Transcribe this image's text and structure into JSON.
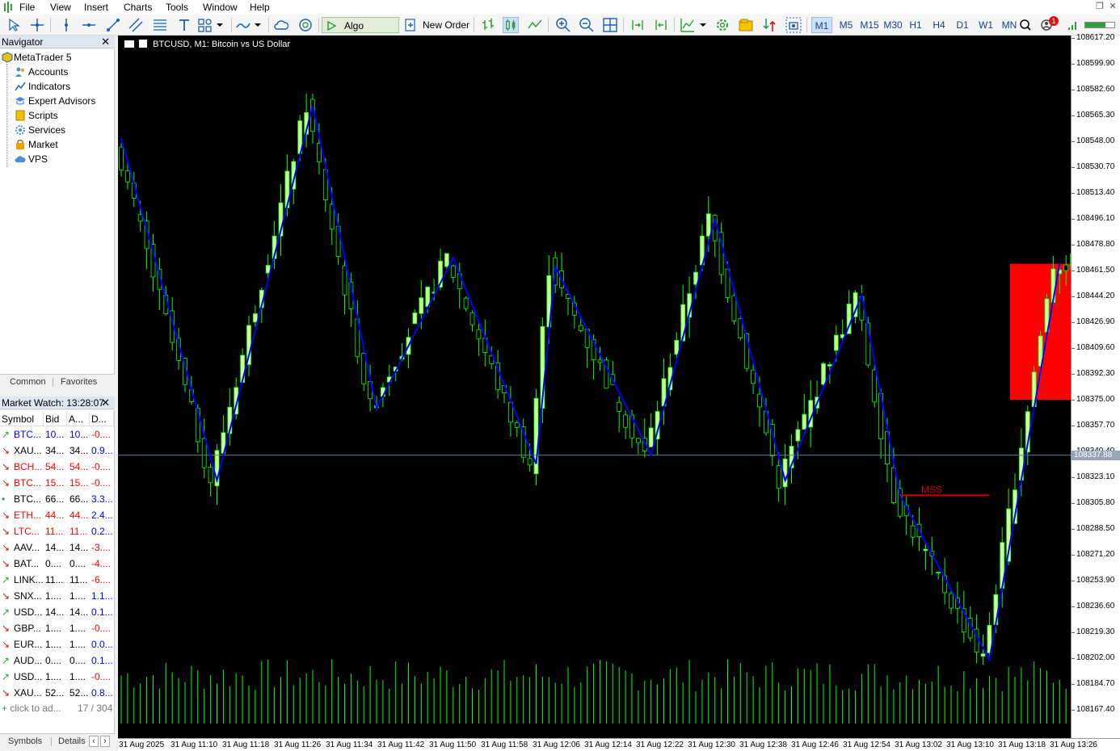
{
  "menu": [
    "File",
    "View",
    "Insert",
    "Charts",
    "Tools",
    "Window",
    "Help"
  ],
  "toolbar": {
    "algo_trading": "Algo Trading",
    "new_order": "New Order",
    "timeframes": [
      "M1",
      "M5",
      "M15",
      "M30",
      "H1",
      "H4",
      "D1",
      "W1",
      "MN"
    ],
    "active_timeframe": "M1",
    "notification_count": "1"
  },
  "navigator": {
    "title": "Navigator",
    "root": "MetaTrader 5",
    "items": [
      "Accounts",
      "Indicators",
      "Expert Advisors",
      "Scripts",
      "Services",
      "Market",
      "VPS"
    ],
    "tabs": [
      "Common",
      "Favorites"
    ]
  },
  "market_watch": {
    "title": "Market Watch: 13:28:07",
    "columns": [
      "Symbol",
      "Bid",
      "A...",
      "D..."
    ],
    "rows": [
      {
        "symbol": "BTC...",
        "bid": "10...",
        "ask": "10...",
        "daily": "-0....",
        "dir": "up",
        "color": "#0000ff",
        "dcolor": "#ff0000"
      },
      {
        "symbol": "XAU...",
        "bid": "34...",
        "ask": "34...",
        "daily": "0.9...",
        "dir": "down",
        "color": "#000000",
        "dcolor": "#0000ff"
      },
      {
        "symbol": "BCH...",
        "bid": "54...",
        "ask": "54...",
        "daily": "-0....",
        "dir": "down",
        "color": "#ff0000",
        "dcolor": "#ff0000"
      },
      {
        "symbol": "BTC...",
        "bid": "15...",
        "ask": "15...",
        "daily": "-0....",
        "dir": "down",
        "color": "#ff0000",
        "dcolor": "#ff0000"
      },
      {
        "symbol": "BTC...",
        "bid": "66...",
        "ask": "66...",
        "daily": "3.3...",
        "dir": "neutral",
        "color": "#000000",
        "dcolor": "#0000ff"
      },
      {
        "symbol": "ETH...",
        "bid": "44...",
        "ask": "44...",
        "daily": "2.4...",
        "dir": "down",
        "color": "#ff0000",
        "dcolor": "#0000ff"
      },
      {
        "symbol": "LTC...",
        "bid": "11...",
        "ask": "11...",
        "daily": "0.2...",
        "dir": "down",
        "color": "#ff0000",
        "dcolor": "#0000ff"
      },
      {
        "symbol": "AAV...",
        "bid": "14...",
        "ask": "14...",
        "daily": "-3....",
        "dir": "down",
        "color": "#000000",
        "dcolor": "#ff0000"
      },
      {
        "symbol": "BAT...",
        "bid": "0....",
        "ask": "0....",
        "daily": "-4....",
        "dir": "down",
        "color": "#000000",
        "dcolor": "#ff0000"
      },
      {
        "symbol": "LINK...",
        "bid": "11...",
        "ask": "11...",
        "daily": "-6....",
        "dir": "up",
        "color": "#000000",
        "dcolor": "#ff0000"
      },
      {
        "symbol": "SNX...",
        "bid": "1....",
        "ask": "1....",
        "daily": "1.1...",
        "dir": "down",
        "color": "#000000",
        "dcolor": "#0000ff"
      },
      {
        "symbol": "USD...",
        "bid": "14...",
        "ask": "14...",
        "daily": "0.1...",
        "dir": "up",
        "color": "#000000",
        "dcolor": "#0000ff"
      },
      {
        "symbol": "GBP...",
        "bid": "1....",
        "ask": "1....",
        "daily": "-0....",
        "dir": "down",
        "color": "#000000",
        "dcolor": "#ff0000"
      },
      {
        "symbol": "EUR...",
        "bid": "1....",
        "ask": "1....",
        "daily": "0.0...",
        "dir": "down",
        "color": "#000000",
        "dcolor": "#0000ff"
      },
      {
        "symbol": "AUD...",
        "bid": "0....",
        "ask": "0....",
        "daily": "0.1...",
        "dir": "up",
        "color": "#000000",
        "dcolor": "#0000ff"
      },
      {
        "symbol": "USD...",
        "bid": "1....",
        "ask": "1....",
        "daily": "-0....",
        "dir": "up",
        "color": "#000000",
        "dcolor": "#ff0000"
      },
      {
        "symbol": "XAU...",
        "bid": "52...",
        "ask": "52...",
        "daily": "0.8...",
        "dir": "down",
        "color": "#000000",
        "dcolor": "#0000ff"
      }
    ],
    "add_hint": "click to ad...",
    "count": "17 / 304",
    "tabs": [
      "Symbols",
      "Details"
    ]
  },
  "chart": {
    "title": "BTCUSD, M1:  Bitcoin vs US Dollar",
    "mss_label": "MSS",
    "current_price": "108337.88",
    "price_labels": [
      "108617.20",
      "108599.90",
      "108582.60",
      "108565.30",
      "108548.00",
      "108530.70",
      "108513.40",
      "108496.10",
      "108478.80",
      "108461.50",
      "108444.20",
      "108426.90",
      "108409.60",
      "108392.30",
      "108375.00",
      "108357.70",
      "108340.40",
      "108323.10",
      "108305.80",
      "108288.50",
      "108271.20",
      "108253.90",
      "108236.60",
      "108219.30",
      "108202.00",
      "108184.70",
      "108167.40"
    ],
    "time_labels": [
      "31 Aug 2025",
      "31 Aug 11:10",
      "31 Aug 11:18",
      "31 Aug 11:26",
      "31 Aug 11:34",
      "31 Aug 11:42",
      "31 Aug 11:50",
      "31 Aug 11:58",
      "31 Aug 12:06",
      "31 Aug 12:14",
      "31 Aug 12:22",
      "31 Aug 12:30",
      "31 Aug 12:38",
      "31 Aug 12:46",
      "31 Aug 12:54",
      "31 Aug 13:02",
      "31 Aug 13:10",
      "31 Aug 13:18",
      "31 Aug 13:26"
    ],
    "colors": {
      "bull": "#ccff99",
      "bear": "#000000",
      "wick": "#00ff00",
      "zigzag": "#0000ff",
      "zone": "#ff0000",
      "mss": "#cc0000",
      "volume": "#00ff00"
    }
  },
  "chart_data": {
    "type": "candlestick",
    "symbol": "BTCUSD",
    "timeframe": "M1",
    "ylim": [
      108160,
      108620
    ],
    "zigzag": [
      108550,
      108321,
      108572,
      108369,
      108470,
      108332,
      108464,
      108338,
      108496,
      108321,
      108445,
      108311,
      108201,
      108466
    ],
    "mss_level": 108311,
    "supply_zone": [
      108375,
      108466
    ],
    "current_price": 108337.88
  }
}
